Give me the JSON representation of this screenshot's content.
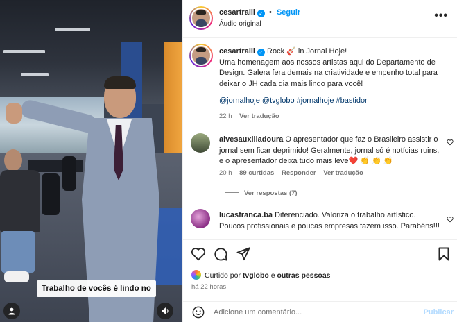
{
  "video": {
    "caption": "Trabalho de vocês é lindo no"
  },
  "header": {
    "username": "cesartralli",
    "follow_label": "Seguir",
    "audio_label": "Áudio original",
    "more_label": "•••"
  },
  "post_caption": {
    "username": "cesartralli",
    "line1": "Rock 🎸 in Jornal Hoje!",
    "body": "Uma homenagem aos nossos artistas aqui do Departamento de Design. Galera fera demais na criatividade e empenho total para deixar o JH cada dia mais lindo para você!",
    "tags": "@jornalhoje @tvglobo #jornalhoje #bastidor",
    "time": "22 h",
    "translate": "Ver tradução"
  },
  "comments": [
    {
      "username": "alvesauxiliadoura",
      "text": "O apresentador que faz o Brasileiro assistir o jornal sem ficar deprimido! Geralmente, jornal só é notícias ruins, e o apresentador deixa tudo mais leve❤️ 👏 👏 👏",
      "time": "20 h",
      "likes": "89 curtidas",
      "reply": "Responder",
      "translate": "Ver tradução",
      "replies": "Ver respostas (7)"
    },
    {
      "username": "lucasfranca.ba",
      "text": "Diferenciado. Valoriza o trabalho artístico. Poucos profissionais e poucas empresas fazem isso. Parabéns!!!",
      "time": "",
      "likes": "",
      "reply": "",
      "translate": ""
    }
  ],
  "actions": {
    "liked_by_prefix": "Curtido por",
    "liked_by_user": "tvglobo",
    "liked_by_connector": "e",
    "liked_by_others": "outras pessoas",
    "timestamp": "há 22 horas"
  },
  "add_comment": {
    "placeholder": "Adicione um comentário...",
    "publish_label": "Publicar"
  },
  "colors": {
    "link_blue": "#0095f6",
    "hashtag_blue": "#00376b",
    "muted": "#737373"
  }
}
